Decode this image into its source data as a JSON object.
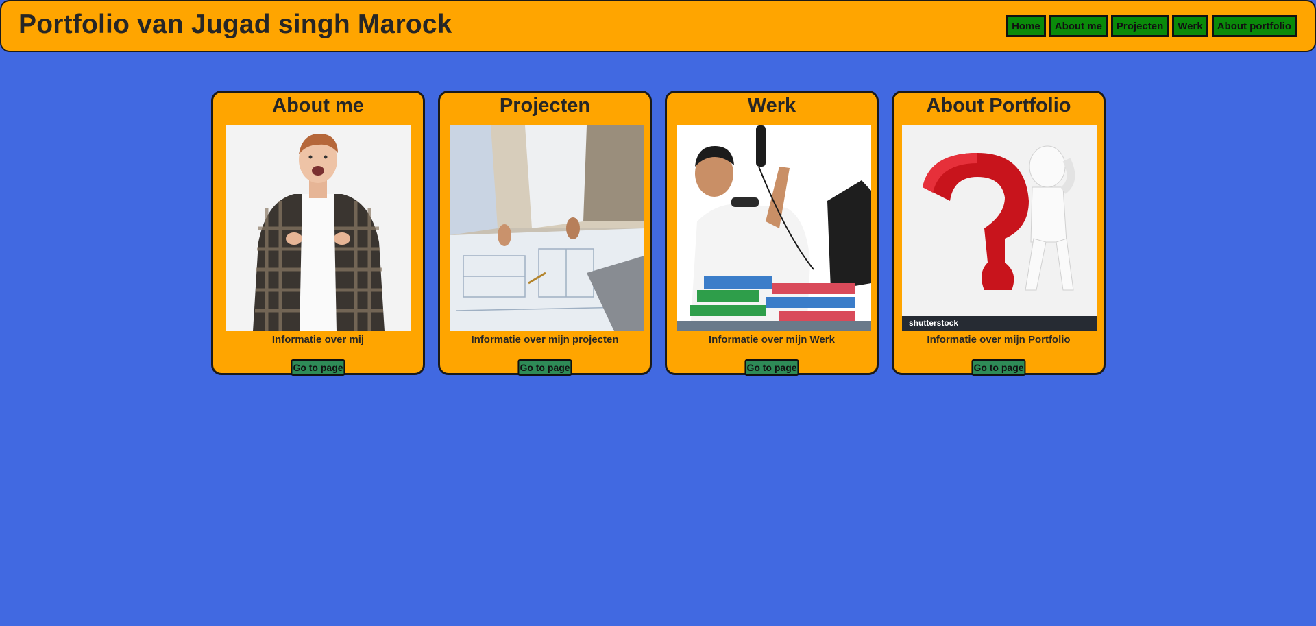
{
  "header": {
    "title": "Portfolio van Jugad singh Marock",
    "nav": [
      "Home",
      "About me",
      "Projecten",
      "Werk",
      "About portfolio"
    ]
  },
  "cards": [
    {
      "title": "About me",
      "description": "Informatie over mij",
      "button": "Go to page",
      "image": "excited-man-pointing-at-himself"
    },
    {
      "title": "Projecten",
      "description": "Informatie over mijn projecten",
      "button": "Go to page",
      "image": "people-reviewing-blueprints"
    },
    {
      "title": "Werk",
      "description": "Informatie over mijn Werk",
      "button": "Go to page",
      "image": "stressed-man-with-phones-at-desk"
    },
    {
      "title": "About Portfolio",
      "description": "Informatie over mijn Portfolio",
      "button": "Go to page",
      "image": "figure-sitting-on-red-question-mark",
      "image_caption": "shutterstock"
    }
  ],
  "colors": {
    "background": "#4169e1",
    "panel": "#ffa500",
    "nav_button": "#0a8a0a",
    "go_button": "#2e8b57"
  }
}
